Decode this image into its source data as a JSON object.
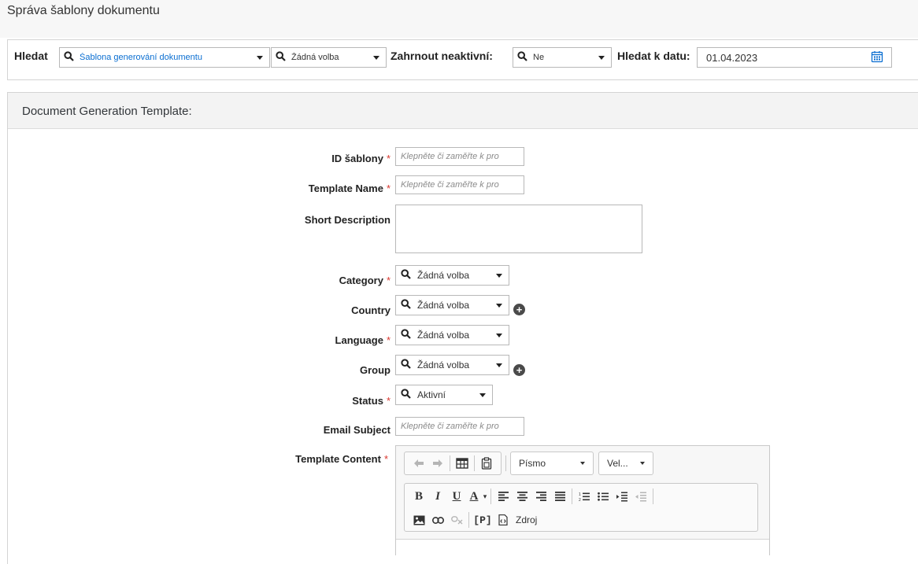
{
  "page_title": "Správa šablony dokumentu",
  "search_bar": {
    "search_label": "Hledat",
    "template_type_value": "Šablona generování dokumentu",
    "template_value": "Žádná volba",
    "include_inactive_label": "Zahrnout neaktivní:",
    "include_inactive_value": "Ne",
    "search_date_label": "Hledat k datu:",
    "search_date_value": "01.04.2023"
  },
  "section": {
    "title": "Document Generation Template:"
  },
  "form": {
    "template_id": {
      "label": "ID šablony",
      "placeholder": "Klepněte či zaměřte k pro"
    },
    "template_name": {
      "label": "Template Name",
      "placeholder": "Klepněte či zaměřte k pro"
    },
    "short_description": {
      "label": "Short Description"
    },
    "category": {
      "label": "Category",
      "value": "Žádná volba"
    },
    "country": {
      "label": "Country",
      "value": "Žádná volba"
    },
    "language": {
      "label": "Language",
      "value": "Žádná volba"
    },
    "group": {
      "label": "Group",
      "value": "Žádná volba"
    },
    "status": {
      "label": "Status",
      "value": "Aktivní"
    },
    "email_subject": {
      "label": "Email Subject",
      "placeholder": "Klepněte či zaměřte k pro"
    },
    "template_content": {
      "label": "Template Content"
    },
    "required_mark": "*"
  },
  "editor": {
    "font_combo": "Písmo",
    "size_combo": "Vel...",
    "bold": "B",
    "italic": "I",
    "underline": "U",
    "text_color": "A",
    "placeholder_tag": "[P]",
    "source": "Zdroj"
  },
  "colors": {
    "link_blue": "#0a6ed1",
    "required_red": "#d9362e",
    "header_bg": "#f3f3f3"
  }
}
